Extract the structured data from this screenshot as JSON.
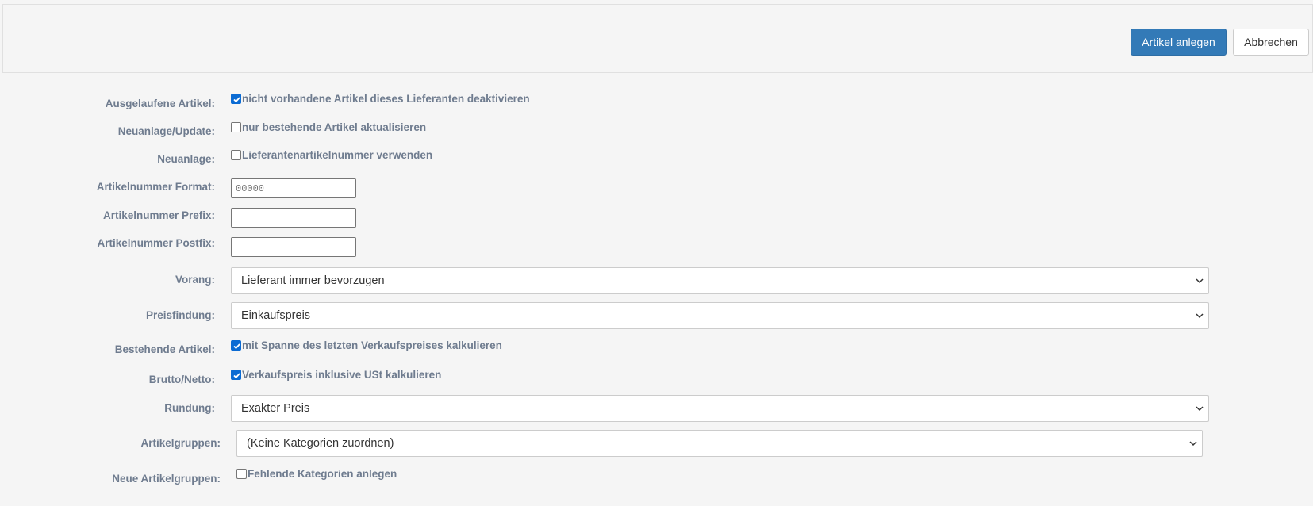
{
  "toolbar": {
    "create_label": "Artikel anlegen",
    "cancel_label": "Abbrechen"
  },
  "form": {
    "discontinued": {
      "label": "Ausgelaufene Artikel:",
      "option": "nicht vorhandene Artikel dieses Lieferanten deaktivieren",
      "checked": true
    },
    "create_update": {
      "label": "Neuanlage/Update:",
      "option": "nur bestehende Artikel aktualisieren",
      "checked": false
    },
    "new_items": {
      "label": "Neuanlage:",
      "option": "Lieferantenartikelnummer verwenden",
      "checked": false
    },
    "number_format": {
      "label": "Artikelnummer Format:",
      "placeholder": "00000",
      "value": ""
    },
    "number_prefix": {
      "label": "Artikelnummer Prefix:",
      "value": ""
    },
    "number_postfix": {
      "label": "Artikelnummer Postfix:",
      "value": ""
    },
    "priority": {
      "label": "Vorang:",
      "selected": "Lieferant immer bevorzugen"
    },
    "pricing": {
      "label": "Preisfindung:",
      "selected": "Einkaufspreis"
    },
    "existing_items": {
      "label": "Bestehende Artikel:",
      "option": "mit Spanne des letzten Verkaufspreises kalkulieren",
      "checked": true
    },
    "gross_net": {
      "label": "Brutto/Netto:",
      "option": "Verkaufspreis inklusive USt kalkulieren",
      "checked": true
    },
    "rounding": {
      "label": "Rundung:",
      "selected": "Exakter Preis"
    },
    "item_groups": {
      "label": "Artikelgruppen:",
      "selected": "(Keine Kategorien zuordnen)"
    },
    "new_item_groups": {
      "label": "Neue Artikelgruppen:",
      "option": "Fehlende Kategorien anlegen",
      "checked": false
    }
  },
  "colors": {
    "primary": "#337ab7",
    "label": "#6f7c8f",
    "checkbox_checked": "#0b6bd3"
  }
}
